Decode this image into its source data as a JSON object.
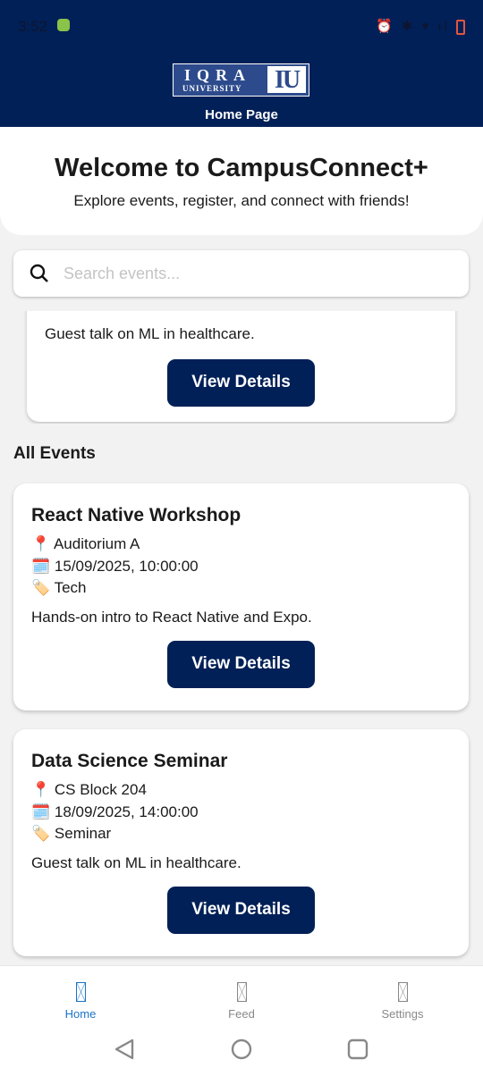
{
  "status": {
    "time": "3:52"
  },
  "header": {
    "logo_text_1": "IQRA",
    "logo_text_2": "UNIVERSITY",
    "logo_mark": "IU",
    "title": "Home Page"
  },
  "welcome": {
    "title": "Welcome to CampusConnect+",
    "subtitle": "Explore events, register, and connect with friends!"
  },
  "search": {
    "placeholder": "Search events..."
  },
  "partial_card": {
    "description": "Guest talk on ML in healthcare.",
    "button": "View Details"
  },
  "section_title": "All Events",
  "events": [
    {
      "title": "React Native Workshop",
      "location": "Auditorium A",
      "datetime": "15/09/2025, 10:00:00",
      "category": "Tech",
      "description": "Hands-on intro to React Native and Expo.",
      "button": "View Details"
    },
    {
      "title": "Data Science Seminar",
      "location": "CS Block 204",
      "datetime": "18/09/2025, 14:00:00",
      "category": "Seminar",
      "description": "Guest talk on ML in healthcare.",
      "button": "View Details"
    }
  ],
  "icons": {
    "location": "📍",
    "date": "🗓️",
    "tag": "🏷️"
  },
  "tabs": [
    {
      "label": "Home"
    },
    {
      "label": "Feed"
    },
    {
      "label": "Settings"
    }
  ],
  "colors": {
    "primary": "#012057",
    "active_tab": "#1a73c9"
  }
}
